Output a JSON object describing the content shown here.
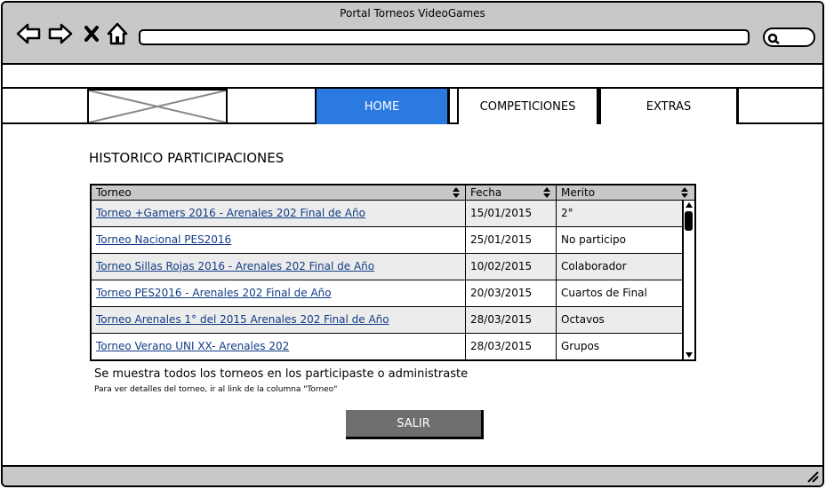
{
  "window": {
    "title": "Portal Torneos VideoGames"
  },
  "browser": {
    "address_value": "",
    "icons": [
      "back-arrow-icon",
      "forward-arrow-icon",
      "stop-icon",
      "home-icon",
      "search-icon"
    ]
  },
  "navbar": {
    "logo": "logo-placeholder",
    "items": [
      {
        "label": "HOME",
        "active": true
      },
      {
        "label": "COMPETICIONES",
        "active": false
      },
      {
        "label": "EXTRAS",
        "active": false
      }
    ]
  },
  "main": {
    "title": "HISTORICO PARTICIPACIONES",
    "table": {
      "columns": [
        "Torneo",
        "Fecha",
        "Merito"
      ],
      "rows": [
        {
          "torneo": "Torneo +Gamers 2016 - Arenales 202 Final de Año",
          "fecha": "15/01/2015",
          "merito": "2°"
        },
        {
          "torneo": "Torneo Nacional PES2016",
          "fecha": "25/01/2015",
          "merito": "No participo"
        },
        {
          "torneo": "Torneo Sillas Rojas 2016 - Arenales 202 Final de Año",
          "fecha": "10/02/2015",
          "merito": "Colaborador"
        },
        {
          "torneo": "Torneo PES2016 - Arenales 202 Final de Año",
          "fecha": "20/03/2015",
          "merito": "Cuartos de Final"
        },
        {
          "torneo": "Torneo Arenales 1° del 2015 Arenales 202 Final de Año",
          "fecha": "28/03/2015",
          "merito": "Octavos"
        },
        {
          "torneo": "Torneo Verano UNI XX- Arenales 202 ",
          "fecha": "28/03/2015",
          "merito": "Grupos"
        }
      ]
    },
    "info_main": "Se muestra todos los torneos en los participaste o administraste",
    "info_sub": "Para ver detalles del torneo, ir al link de la columna \"Torneo\"",
    "exit_button": "SALIR"
  },
  "colors": {
    "chrome": "#c8c8c8",
    "active_nav": "#2a7ae2",
    "link": "#123c85",
    "button": "#6e6e6e"
  }
}
